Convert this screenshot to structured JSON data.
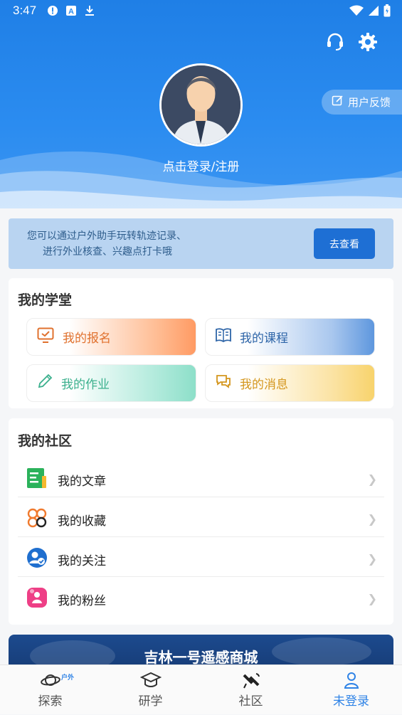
{
  "status_bar": {
    "time": "3:47"
  },
  "header": {
    "feedback_label": "用户反馈",
    "login_prompt": "点击登录/注册"
  },
  "banner": {
    "line1": "您可以通过户外助手玩转轨迹记录、",
    "line2": "进行外业核查、兴趣点打卡哦",
    "button": "去查看"
  },
  "study": {
    "title": "我的学堂",
    "items": [
      {
        "label": "我的报名"
      },
      {
        "label": "我的课程"
      },
      {
        "label": "我的作业"
      },
      {
        "label": "我的消息"
      }
    ]
  },
  "community": {
    "title": "我的社区",
    "items": [
      {
        "label": "我的文章"
      },
      {
        "label": "我的收藏"
      },
      {
        "label": "我的关注"
      },
      {
        "label": "我的粉丝"
      }
    ]
  },
  "promo": {
    "title": "吉林一号遥感商城"
  },
  "bottom_nav": {
    "items": [
      {
        "label": "探索",
        "tag": "户外"
      },
      {
        "label": "研学"
      },
      {
        "label": "社区"
      },
      {
        "label": "未登录"
      }
    ]
  },
  "colors": {
    "primary": "#2b8cf0",
    "button": "#1e6fd4",
    "active_nav": "#2f83e6"
  }
}
